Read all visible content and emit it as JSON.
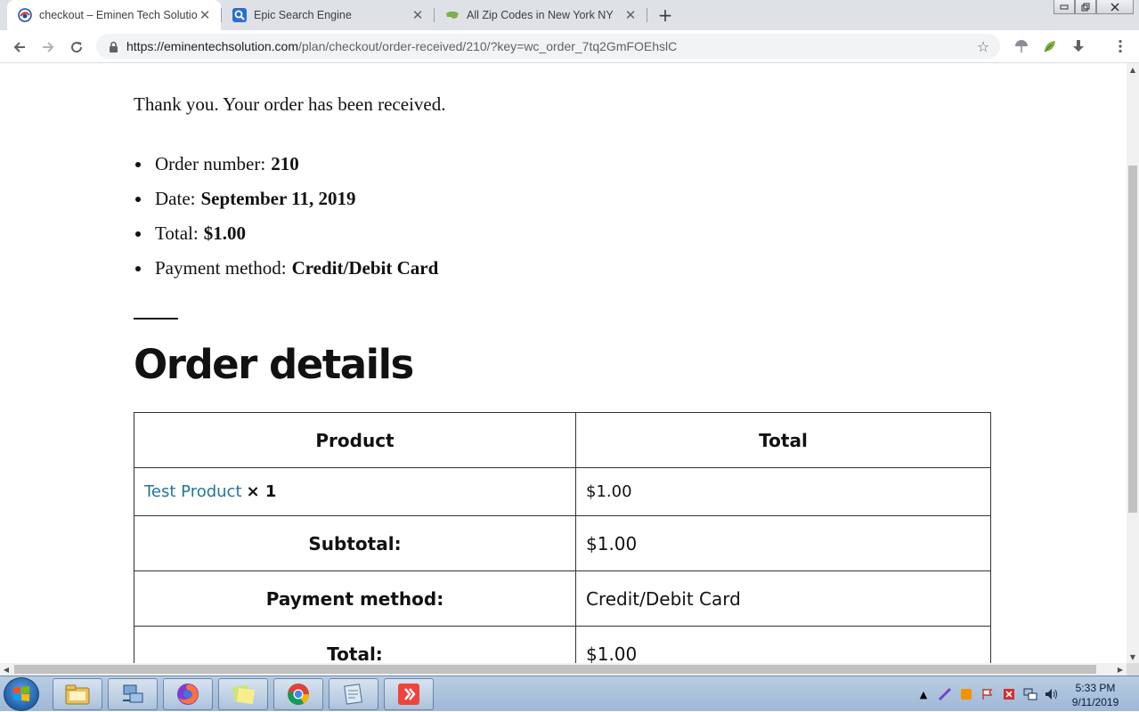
{
  "browser": {
    "tabs": [
      {
        "title": "checkout – Eminen Tech Solution",
        "favicon": "edge-like-icon",
        "active": true
      },
      {
        "title": "Epic Search Engine",
        "favicon": "search-magnifier-icon",
        "active": false
      },
      {
        "title": "All Zip Codes in New York NY",
        "favicon": "us-map-icon",
        "active": false
      }
    ],
    "newtab_glyph": "+",
    "close_glyph": "✕",
    "url_host": "https://eminentechsolution.com",
    "url_path": "/plan/checkout/order-received/210/?key=wc_order_7tq2GmFOEhslC",
    "window_controls": [
      "minimize",
      "restore",
      "close"
    ]
  },
  "page": {
    "thank_you": "Thank you. Your order has been received.",
    "order_overview": [
      {
        "label": "Order number:",
        "value": "210"
      },
      {
        "label": "Date:",
        "value": "September 11, 2019"
      },
      {
        "label": "Total:",
        "value": "$1.00"
      },
      {
        "label": "Payment method:",
        "value": "Credit/Debit Card"
      }
    ],
    "details_heading": "Order details",
    "table": {
      "col_product": "Product",
      "col_total": "Total",
      "item": {
        "name": "Test Product",
        "qty": "× 1",
        "total": "$1.00"
      },
      "subtotal_label": "Subtotal:",
      "subtotal_value": "$1.00",
      "payment_label": "Payment method:",
      "payment_value": "Credit/Debit Card",
      "total_label": "Total:",
      "total_value": "$1.00"
    }
  },
  "taskbar": {
    "pinned": [
      "file-explorer-icon",
      "network-icon",
      "firefox-icon",
      "sticky-notes-icon",
      "chrome-icon",
      "notepad-icon",
      "anydesk-icon"
    ],
    "clock_time": "5:33 PM",
    "clock_date": "9/11/2019"
  },
  "colors": {
    "link": "#21759b",
    "tabstrip": "#dee1e6",
    "taskbar": "#a9c1dd"
  }
}
